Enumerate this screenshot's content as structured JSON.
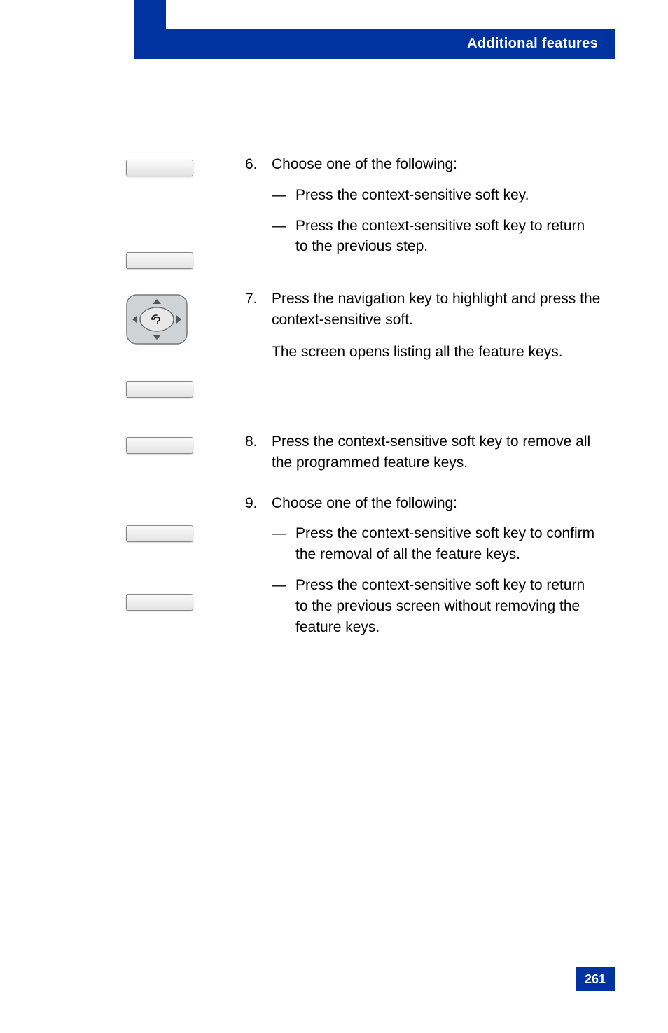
{
  "header": {
    "title": "Additional features"
  },
  "steps": {
    "s6": {
      "num": "6.",
      "lead": "Choose one of the following:",
      "items": [
        {
          "pre": "Press the ",
          "post": " context-sensitive soft key."
        },
        {
          "pre": "Press the ",
          "post": " context-sensitive soft key to return to the previous step."
        }
      ]
    },
    "s7": {
      "num": "7.",
      "l1a": "Press the ",
      "l1b": " navigation key to highlight ",
      "l1c": " and press the ",
      "l1d": " context-sensitive soft.",
      "l2a": "The ",
      "l2b": " screen opens listing all the feature keys."
    },
    "s8": {
      "num": "8.",
      "t1": "Press the ",
      "t2": " context-sensitive soft key to remove all the programmed feature keys."
    },
    "s9": {
      "num": "9.",
      "lead": "Choose one of the following:",
      "items": [
        {
          "pre": "Press the ",
          "post": " context-sensitive soft key to confirm the removal of all the feature keys."
        },
        {
          "pre": "Press the ",
          "post": " context-sensitive soft key to return to the previous screen without removing the feature keys."
        }
      ]
    }
  },
  "dash": "—",
  "page_number": "261"
}
